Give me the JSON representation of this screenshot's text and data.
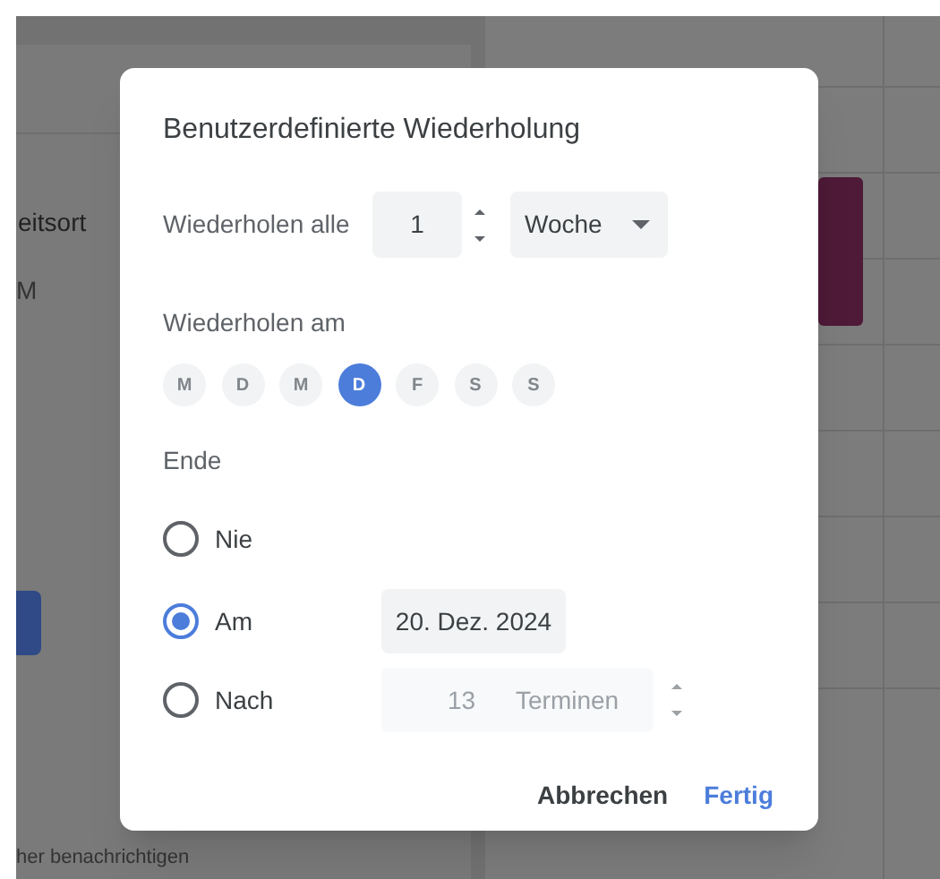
{
  "background": {
    "left_panel": {
      "label_1": "eitsort",
      "label_2": "M",
      "footer": "her benachrichtigen"
    }
  },
  "dialog": {
    "title": "Benutzerdefinierte Wiederholung",
    "repeat_every": {
      "label": "Wiederholen alle",
      "value": "1",
      "unit": "Woche"
    },
    "repeat_on": {
      "label": "Wiederholen am",
      "days": [
        {
          "label": "M",
          "selected": false
        },
        {
          "label": "D",
          "selected": false
        },
        {
          "label": "M",
          "selected": false
        },
        {
          "label": "D",
          "selected": true
        },
        {
          "label": "F",
          "selected": false
        },
        {
          "label": "S",
          "selected": false
        },
        {
          "label": "S",
          "selected": false
        }
      ]
    },
    "ends": {
      "label": "Ende",
      "options": [
        {
          "label": "Nie",
          "selected": false
        },
        {
          "label": "Am",
          "selected": true,
          "field": {
            "kind": "date",
            "value": "20. Dez. 2024",
            "disabled": false
          }
        },
        {
          "label": "Nach",
          "selected": false,
          "field": {
            "kind": "count",
            "value": "13",
            "unit": "Terminen",
            "disabled": true
          }
        }
      ]
    },
    "buttons": [
      {
        "label": "Abbrechen",
        "kind": "secondary"
      },
      {
        "label": "Fertig",
        "kind": "primary"
      }
    ]
  }
}
